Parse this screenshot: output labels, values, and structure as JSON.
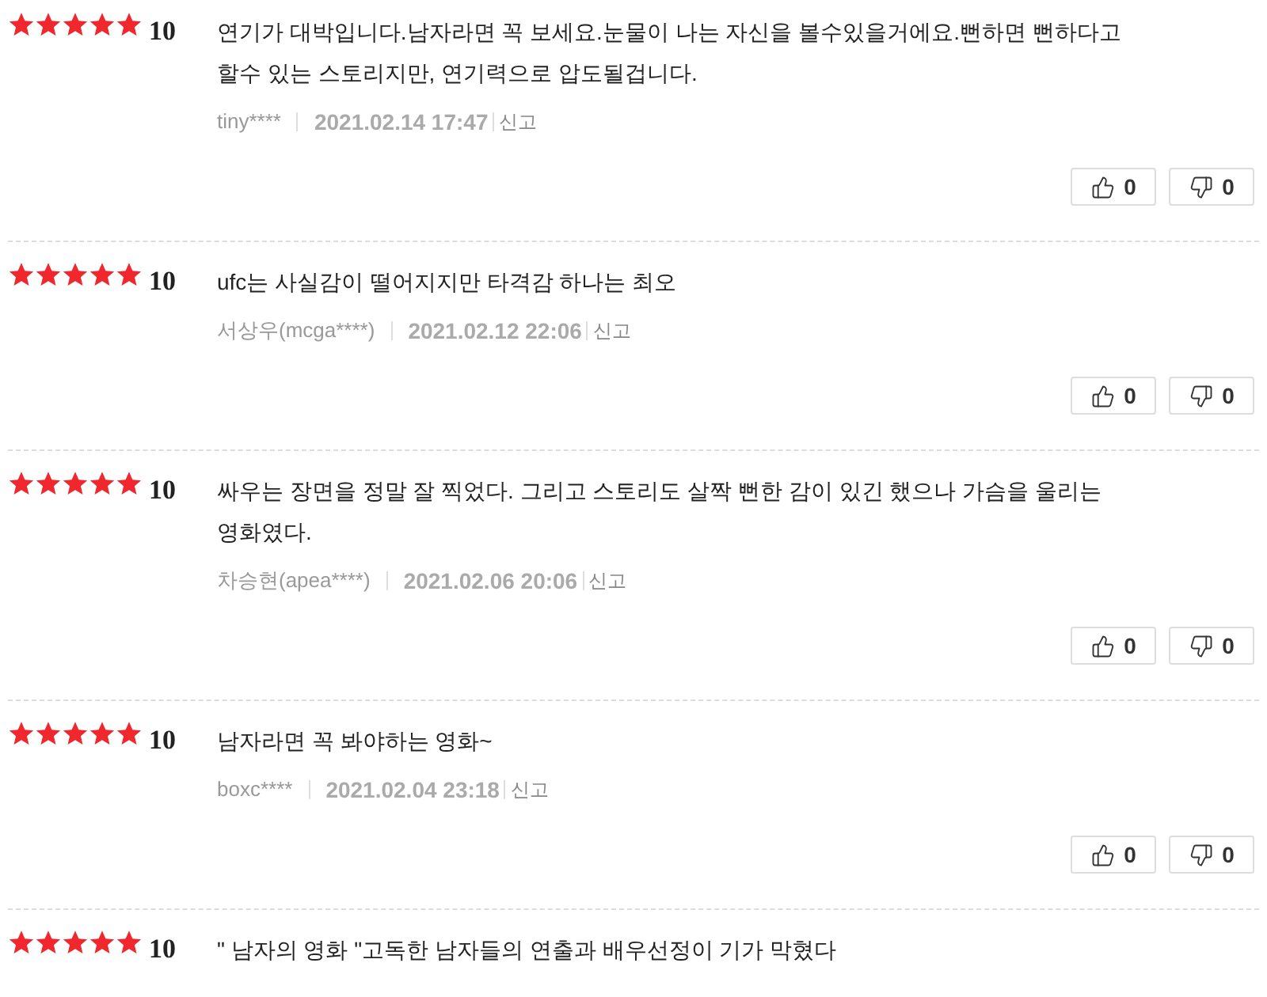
{
  "reviews": [
    {
      "stars": 5,
      "score": "10",
      "text_lines": [
        "연기가 대박입니다.남자라면 꼭 보세요.눈물이 나는 자신을 볼수있을거에요.뻔하면 뻔하다고",
        "할수 있는 스토리지만, 연기력으로 압도될겁니다."
      ],
      "user": "tiny****",
      "date": "2021.02.14 17:47",
      "report": "신고",
      "likes": "0",
      "dislikes": "0"
    },
    {
      "stars": 5,
      "score": "10",
      "text_lines": [
        "ufc는 사실감이 떨어지지만 타격감 하나는 최오"
      ],
      "user": "서상우(mcga****)",
      "date": "2021.02.12 22:06",
      "report": "신고",
      "likes": "0",
      "dislikes": "0"
    },
    {
      "stars": 5,
      "score": "10",
      "text_lines": [
        "싸우는 장면을 정말 잘 찍었다. 그리고 스토리도 살짝 뻔한 감이 있긴 했으나 가슴을 울리는",
        "영화였다."
      ],
      "user": "차승현(apea****)",
      "date": "2021.02.06 20:06",
      "report": "신고",
      "likes": "0",
      "dislikes": "0"
    },
    {
      "stars": 5,
      "score": "10",
      "text_lines": [
        "남자라면 꼭 봐야하는 영화~"
      ],
      "user": "boxc****",
      "date": "2021.02.04 23:18",
      "report": "신고",
      "likes": "0",
      "dislikes": "0"
    },
    {
      "stars": 5,
      "score": "10",
      "text_lines": [
        "\" 남자의 영화 \"고독한 남자들의 연출과 배우선정이 기가 막혔다"
      ]
    }
  ]
}
